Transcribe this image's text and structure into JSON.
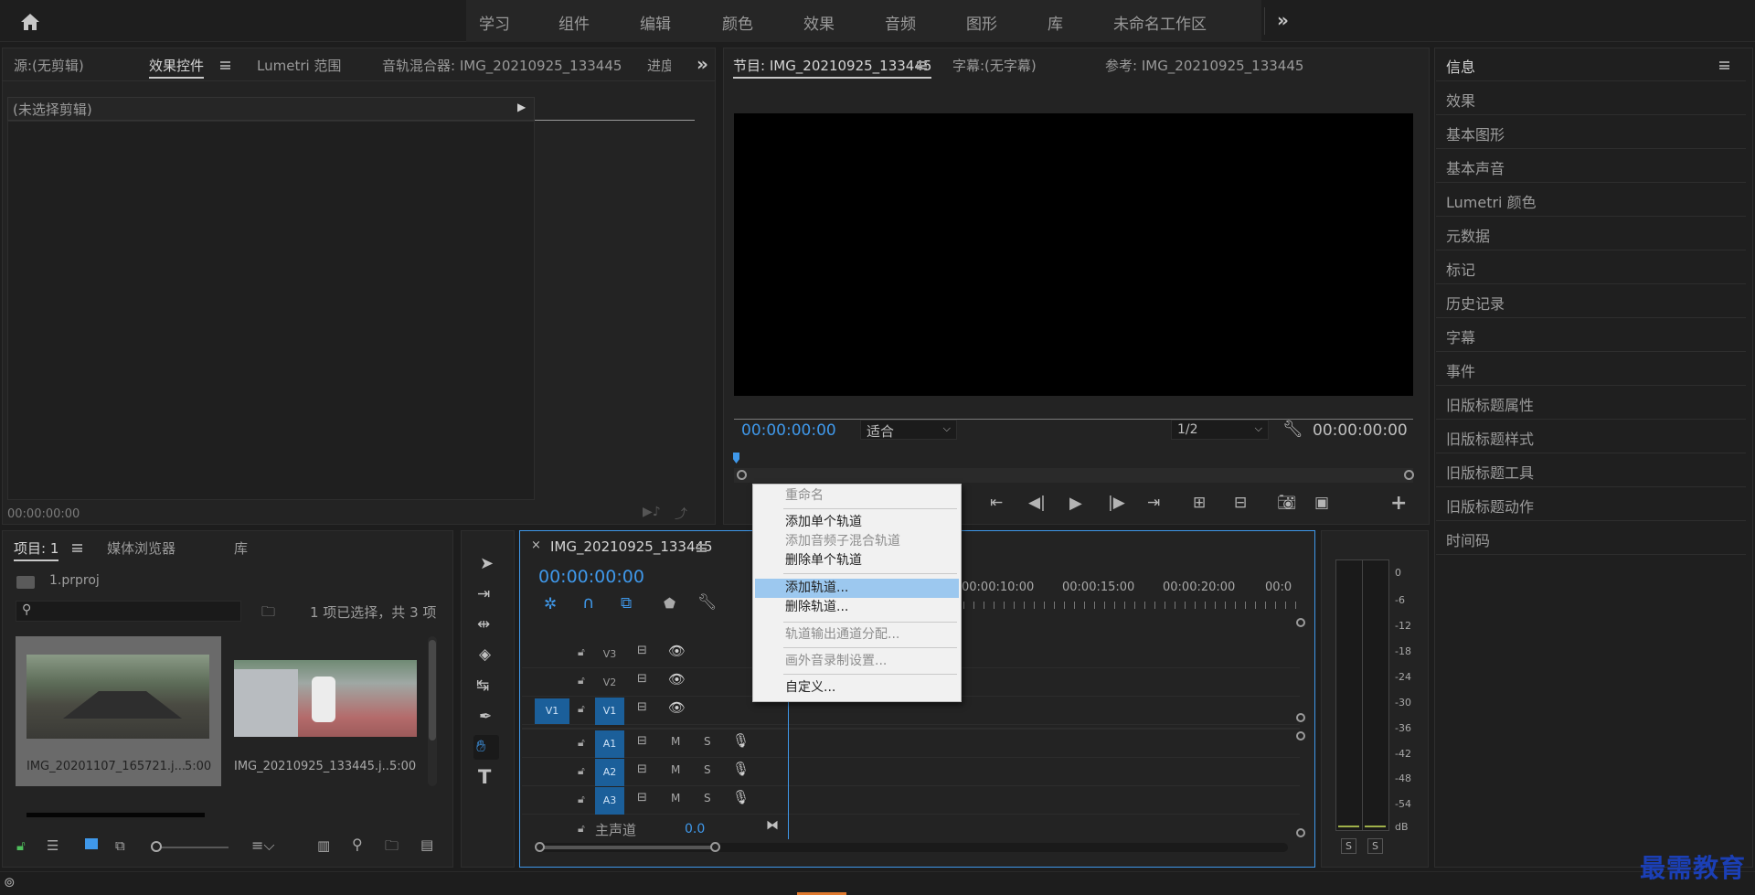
{
  "workspaces": {
    "items": [
      "学习",
      "组件",
      "编辑",
      "颜色",
      "效果",
      "音频",
      "图形",
      "库",
      "未命名工作区"
    ],
    "active_index": 2
  },
  "source_panel": {
    "tabs": [
      "源:(无剪辑)",
      "效果控件",
      "Lumetri 范围",
      "音轨混合器: IMG_20210925_133445",
      "进度"
    ],
    "no_clip_text": "(未选择剪辑)",
    "timecode": "00:00:00:00"
  },
  "program_panel": {
    "tabs": [
      "节目: IMG_20210925_133445",
      "字幕:(无字幕)",
      "参考: IMG_20210925_133445"
    ],
    "timecode_left": "00:00:00:00",
    "fit_select": "适合",
    "resolution_select": "1/2",
    "timecode_right": "00:00:00:00"
  },
  "right_panel": {
    "items": [
      "信息",
      "效果",
      "基本图形",
      "基本声音",
      "Lumetri 颜色",
      "元数据",
      "标记",
      "历史记录",
      "字幕",
      "事件",
      "旧版标题属性",
      "旧版标题样式",
      "旧版标题工具",
      "旧版标题动作",
      "时间码"
    ]
  },
  "project_panel": {
    "tabs": [
      "项目: 1",
      "媒体浏览器",
      "库"
    ],
    "project_file": "1.prproj",
    "search_placeholder": "",
    "selection_status": "1 项已选择，共 3 项",
    "clips": [
      {
        "name": "IMG_20201107_165721.j...",
        "duration": "5:00"
      },
      {
        "name": "IMG_20210925_133445.j...",
        "duration": "5:00"
      }
    ]
  },
  "timeline": {
    "sequence_name": "IMG_20210925_133445",
    "timecode": "00:00:00:00",
    "ruler_labels": [
      "00:00:10:00",
      "00:00:15:00",
      "00:00:20:00",
      "00:0"
    ],
    "video_tracks": [
      "V3",
      "V2",
      "V1"
    ],
    "source_patch": "V1",
    "audio_tracks": [
      "A1",
      "A2",
      "A3"
    ],
    "mute_label": "M",
    "solo_label": "S",
    "master_label": "主声道",
    "master_value": "0.0"
  },
  "context_menu": {
    "items": [
      {
        "label": "重命名",
        "enabled": false
      },
      {
        "label": "添加单个轨道",
        "enabled": true
      },
      {
        "label": "添加音频子混合轨道",
        "enabled": false
      },
      {
        "label": "删除单个轨道",
        "enabled": true
      },
      {
        "label": "添加轨道...",
        "enabled": true,
        "selected": true
      },
      {
        "label": "删除轨道...",
        "enabled": true
      },
      {
        "label": "轨道输出通道分配...",
        "enabled": false
      },
      {
        "label": "画外音录制设置...",
        "enabled": false
      },
      {
        "label": "自定义...",
        "enabled": true
      }
    ]
  },
  "audio_meter": {
    "ticks": [
      "0",
      "-6",
      "-12",
      "-18",
      "-24",
      "-30",
      "-36",
      "-42",
      "-48",
      "-54",
      "dB"
    ],
    "solo_buttons": [
      "S",
      "S"
    ]
  },
  "watermark": "最需教育",
  "colors": {
    "accent_blue": "#3f98ea",
    "track_blue": "#1b5f9a",
    "menu_highlight": "#9cc8ef"
  }
}
